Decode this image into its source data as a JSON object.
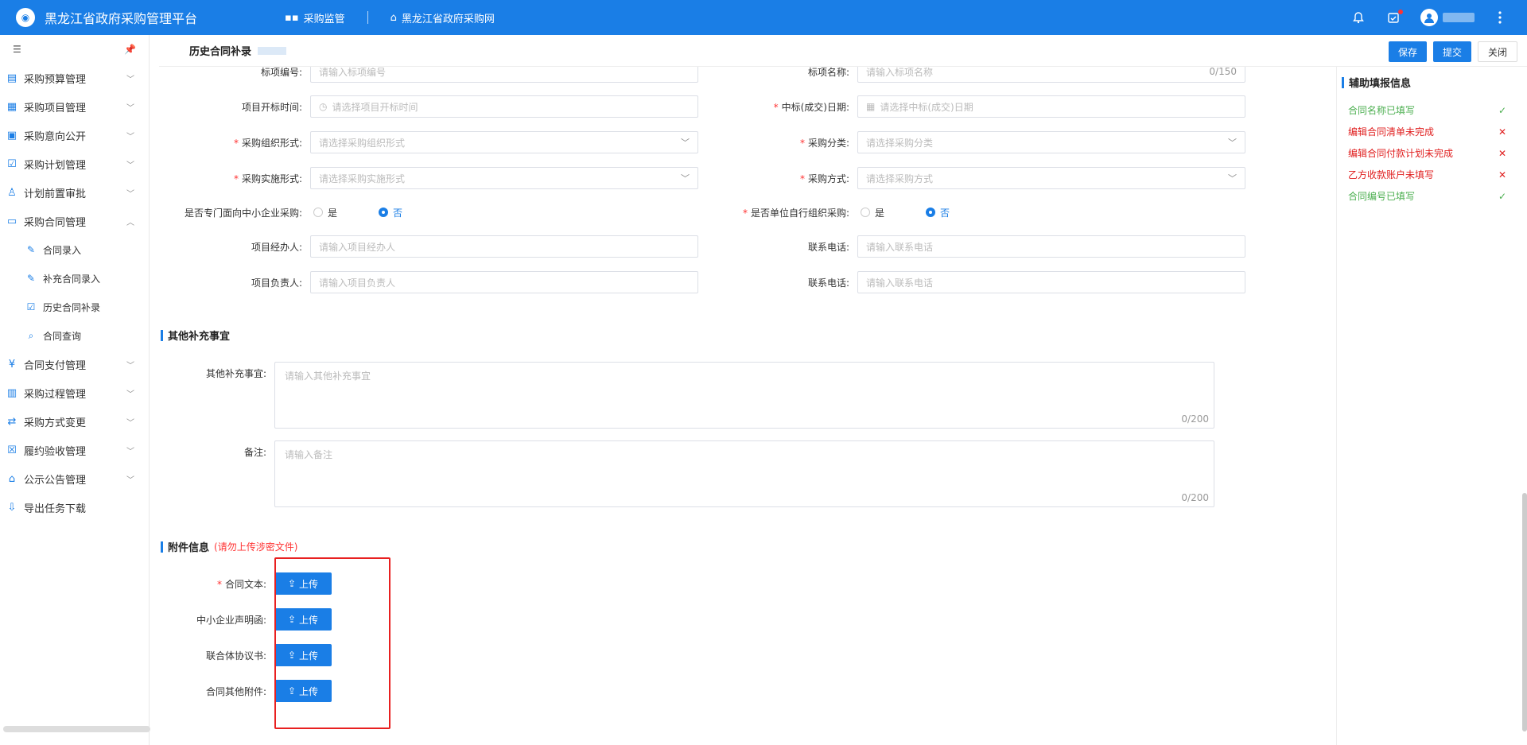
{
  "header": {
    "app_title": "黑龙江省政府采购管理平台",
    "nav": [
      {
        "label": "采购监管"
      },
      {
        "label": "黑龙江省政府采购网"
      }
    ]
  },
  "sidebar": {
    "items": [
      {
        "label": "采购预算管理",
        "icon": "budget-icon"
      },
      {
        "label": "采购项目管理",
        "icon": "project-icon"
      },
      {
        "label": "采购意向公开",
        "icon": "intent-icon"
      },
      {
        "label": "采购计划管理",
        "icon": "plan-icon"
      },
      {
        "label": "计划前置审批",
        "icon": "approve-icon"
      },
      {
        "label": "采购合同管理",
        "icon": "contract-icon",
        "expanded": true
      },
      {
        "label": "合同支付管理",
        "icon": "pay-icon"
      },
      {
        "label": "采购过程管理",
        "icon": "process-icon"
      },
      {
        "label": "采购方式变更",
        "icon": "change-icon"
      },
      {
        "label": "履约验收管理",
        "icon": "accept-icon"
      },
      {
        "label": "公示公告管理",
        "icon": "notice-icon"
      },
      {
        "label": "导出任务下载",
        "icon": "download-icon"
      }
    ],
    "subitems": [
      {
        "label": "合同录入"
      },
      {
        "label": "补充合同录入"
      },
      {
        "label": "历史合同补录"
      },
      {
        "label": "合同查询"
      }
    ]
  },
  "page": {
    "title": "历史合同补录",
    "actions": {
      "save": "保存",
      "submit": "提交",
      "close": "关闭"
    }
  },
  "form": {
    "bid_no": {
      "label": "标项编号:",
      "placeholder": "请输入标项编号"
    },
    "bid_name": {
      "label": "标项名称:",
      "placeholder": "请输入标项名称",
      "counter": "0/150"
    },
    "open_time": {
      "label": "项目开标时间:",
      "placeholder": "请选择项目开标时间"
    },
    "win_date": {
      "label": "中标(成交)日期:",
      "placeholder": "请选择中标(成交)日期"
    },
    "org_form": {
      "label": "采购组织形式:",
      "placeholder": "请选择采购组织形式"
    },
    "category": {
      "label": "采购分类:",
      "placeholder": "请选择采购分类"
    },
    "impl_form": {
      "label": "采购实施形式:",
      "placeholder": "请选择采购实施形式"
    },
    "method": {
      "label": "采购方式:",
      "placeholder": "请选择采购方式"
    },
    "sme": {
      "label": "是否专门面向中小企业采购:",
      "yes": "是",
      "no": "否",
      "selected": "否"
    },
    "self_org": {
      "label": "是否单位自行组织采购:",
      "yes": "是",
      "no": "否",
      "selected": "否"
    },
    "handler": {
      "label": "项目经办人:",
      "placeholder": "请输入项目经办人"
    },
    "handler_phone": {
      "label": "联系电话:",
      "placeholder": "请输入联系电话"
    },
    "leader": {
      "label": "项目负责人:",
      "placeholder": "请输入项目负责人"
    },
    "leader_phone": {
      "label": "联系电话:",
      "placeholder": "请输入联系电话"
    }
  },
  "other": {
    "section": "其他补充事宜",
    "matters": {
      "label": "其他补充事宜:",
      "placeholder": "请输入其他补充事宜",
      "counter": "0/200"
    },
    "remark": {
      "label": "备注:",
      "placeholder": "请输入备注",
      "counter": "0/200"
    }
  },
  "attach": {
    "section": "附件信息",
    "warning": "(请勿上传涉密文件)",
    "upload_label": "上传",
    "rows": [
      {
        "label": "合同文本:"
      },
      {
        "label": "中小企业声明函:"
      },
      {
        "label": "联合体协议书:"
      },
      {
        "label": "合同其他附件:"
      }
    ]
  },
  "helper": {
    "title": "辅助填报信息",
    "items": [
      {
        "text": "合同名称已填写",
        "mark": "✓"
      },
      {
        "text": "编辑合同清单未完成",
        "mark": "✕"
      },
      {
        "text": "编辑合同付款计划未完成",
        "mark": "✕"
      },
      {
        "text": "乙方收款账户未填写",
        "mark": "✕"
      },
      {
        "text": "合同编号已填写",
        "mark": "✓"
      }
    ]
  }
}
